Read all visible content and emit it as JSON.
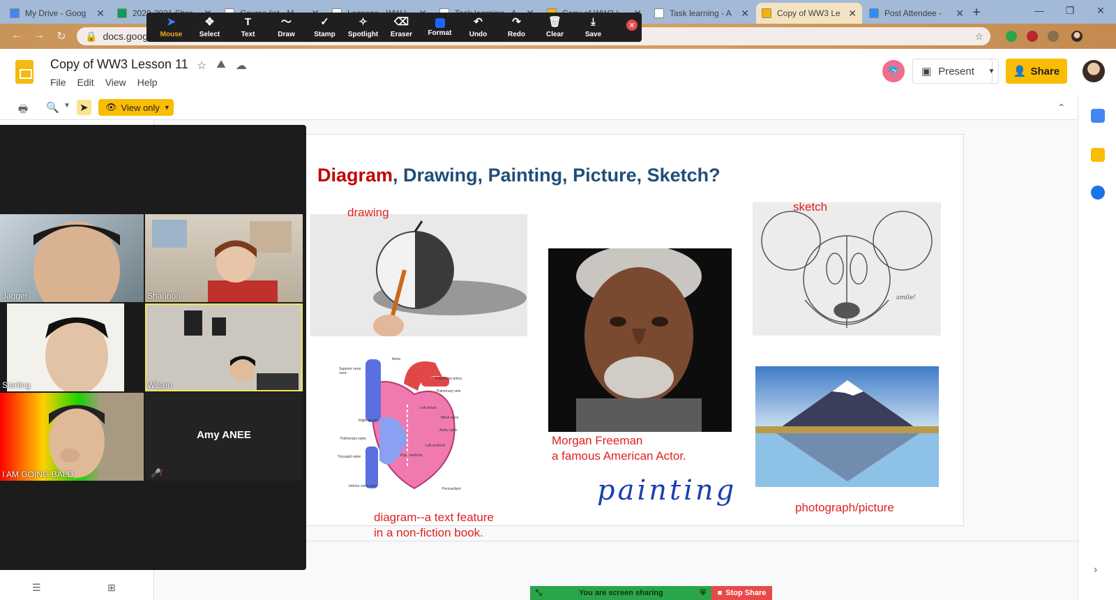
{
  "browser": {
    "tabs": [
      {
        "title": "My Drive - Goog",
        "color": "#4285f4",
        "active": false
      },
      {
        "title": "2020-2021 Shar",
        "color": "#0f9d58",
        "active": false
      },
      {
        "title": "Course list - M",
        "color": "#ffffff",
        "active": false
      },
      {
        "title": "Lessons - WW L",
        "color": "#ffffff",
        "active": false
      },
      {
        "title": "Task learning - A",
        "color": "#ffffff",
        "active": false
      },
      {
        "title": "Copy of WW3 L",
        "color": "#f4b400",
        "active": false
      },
      {
        "title": "Task learning - A",
        "color": "#ffffff",
        "active": false
      },
      {
        "title": "Copy of WW3 Le",
        "color": "#f4b400",
        "active": true
      },
      {
        "title": "Post Attendee -",
        "color": "#2d8cff",
        "active": false
      }
    ],
    "url": "docs.googl"
  },
  "annotation_toolbar": {
    "tools": [
      {
        "label": "Mouse",
        "icon": "➤",
        "name": "mouse-tool"
      },
      {
        "label": "Select",
        "icon": "✥",
        "name": "select-tool"
      },
      {
        "label": "Text",
        "icon": "T",
        "name": "text-tool"
      },
      {
        "label": "Draw",
        "icon": "〜",
        "name": "draw-tool"
      },
      {
        "label": "Stamp",
        "icon": "✓",
        "name": "stamp-tool"
      },
      {
        "label": "Spotlight",
        "icon": "✧",
        "name": "spotlight-tool"
      },
      {
        "label": "Eraser",
        "icon": "⌫",
        "name": "eraser-tool"
      },
      {
        "label": "Format",
        "icon": "",
        "name": "format-tool"
      },
      {
        "label": "Undo",
        "icon": "↶",
        "name": "undo-tool"
      },
      {
        "label": "Redo",
        "icon": "↷",
        "name": "redo-tool"
      },
      {
        "label": "Clear",
        "icon": "🗑",
        "name": "clear-tool"
      },
      {
        "label": "Save",
        "icon": "⤓",
        "name": "save-tool"
      }
    ]
  },
  "doc": {
    "title": "Copy of WW3 Lesson 11",
    "menus": [
      "File",
      "Edit",
      "View",
      "Help"
    ],
    "present_label": "Present",
    "share_label": "Share",
    "view_only_label": "View only"
  },
  "slide": {
    "title_highlight": "Diagram",
    "title_rest": ", Drawing, Painting, Picture, Sketch?",
    "labels": {
      "drawing": "drawing",
      "sketch": "sketch",
      "portrait_line1": "Morgan Freeman",
      "portrait_line2": "a famous American Actor.",
      "painting": "painting",
      "photograph": "photograph/picture",
      "diagram_line1": "diagram--a text feature",
      "diagram_line2": "in a non-fiction book."
    },
    "heart_labels": [
      "Superior vena cava",
      "Aorta",
      "Pulmonary artery",
      "Pulmonary vein",
      "Left atrium",
      "Right atrium",
      "Mitral valve",
      "Aortic valve",
      "Right ventricle",
      "Left ventricle",
      "Pulmonary valve",
      "Tricuspid valve",
      "Inferior vena cava",
      "Pericardium"
    ],
    "sketch_note": "smile!"
  },
  "zoom": {
    "participants": [
      "Jagger",
      "Shannon",
      "Sterling",
      "Wilson",
      "I AM GOING BALD",
      "Amy ANEE"
    ]
  },
  "sharebar": {
    "status": "You are screen sharing",
    "stop_label": "Stop Share"
  }
}
